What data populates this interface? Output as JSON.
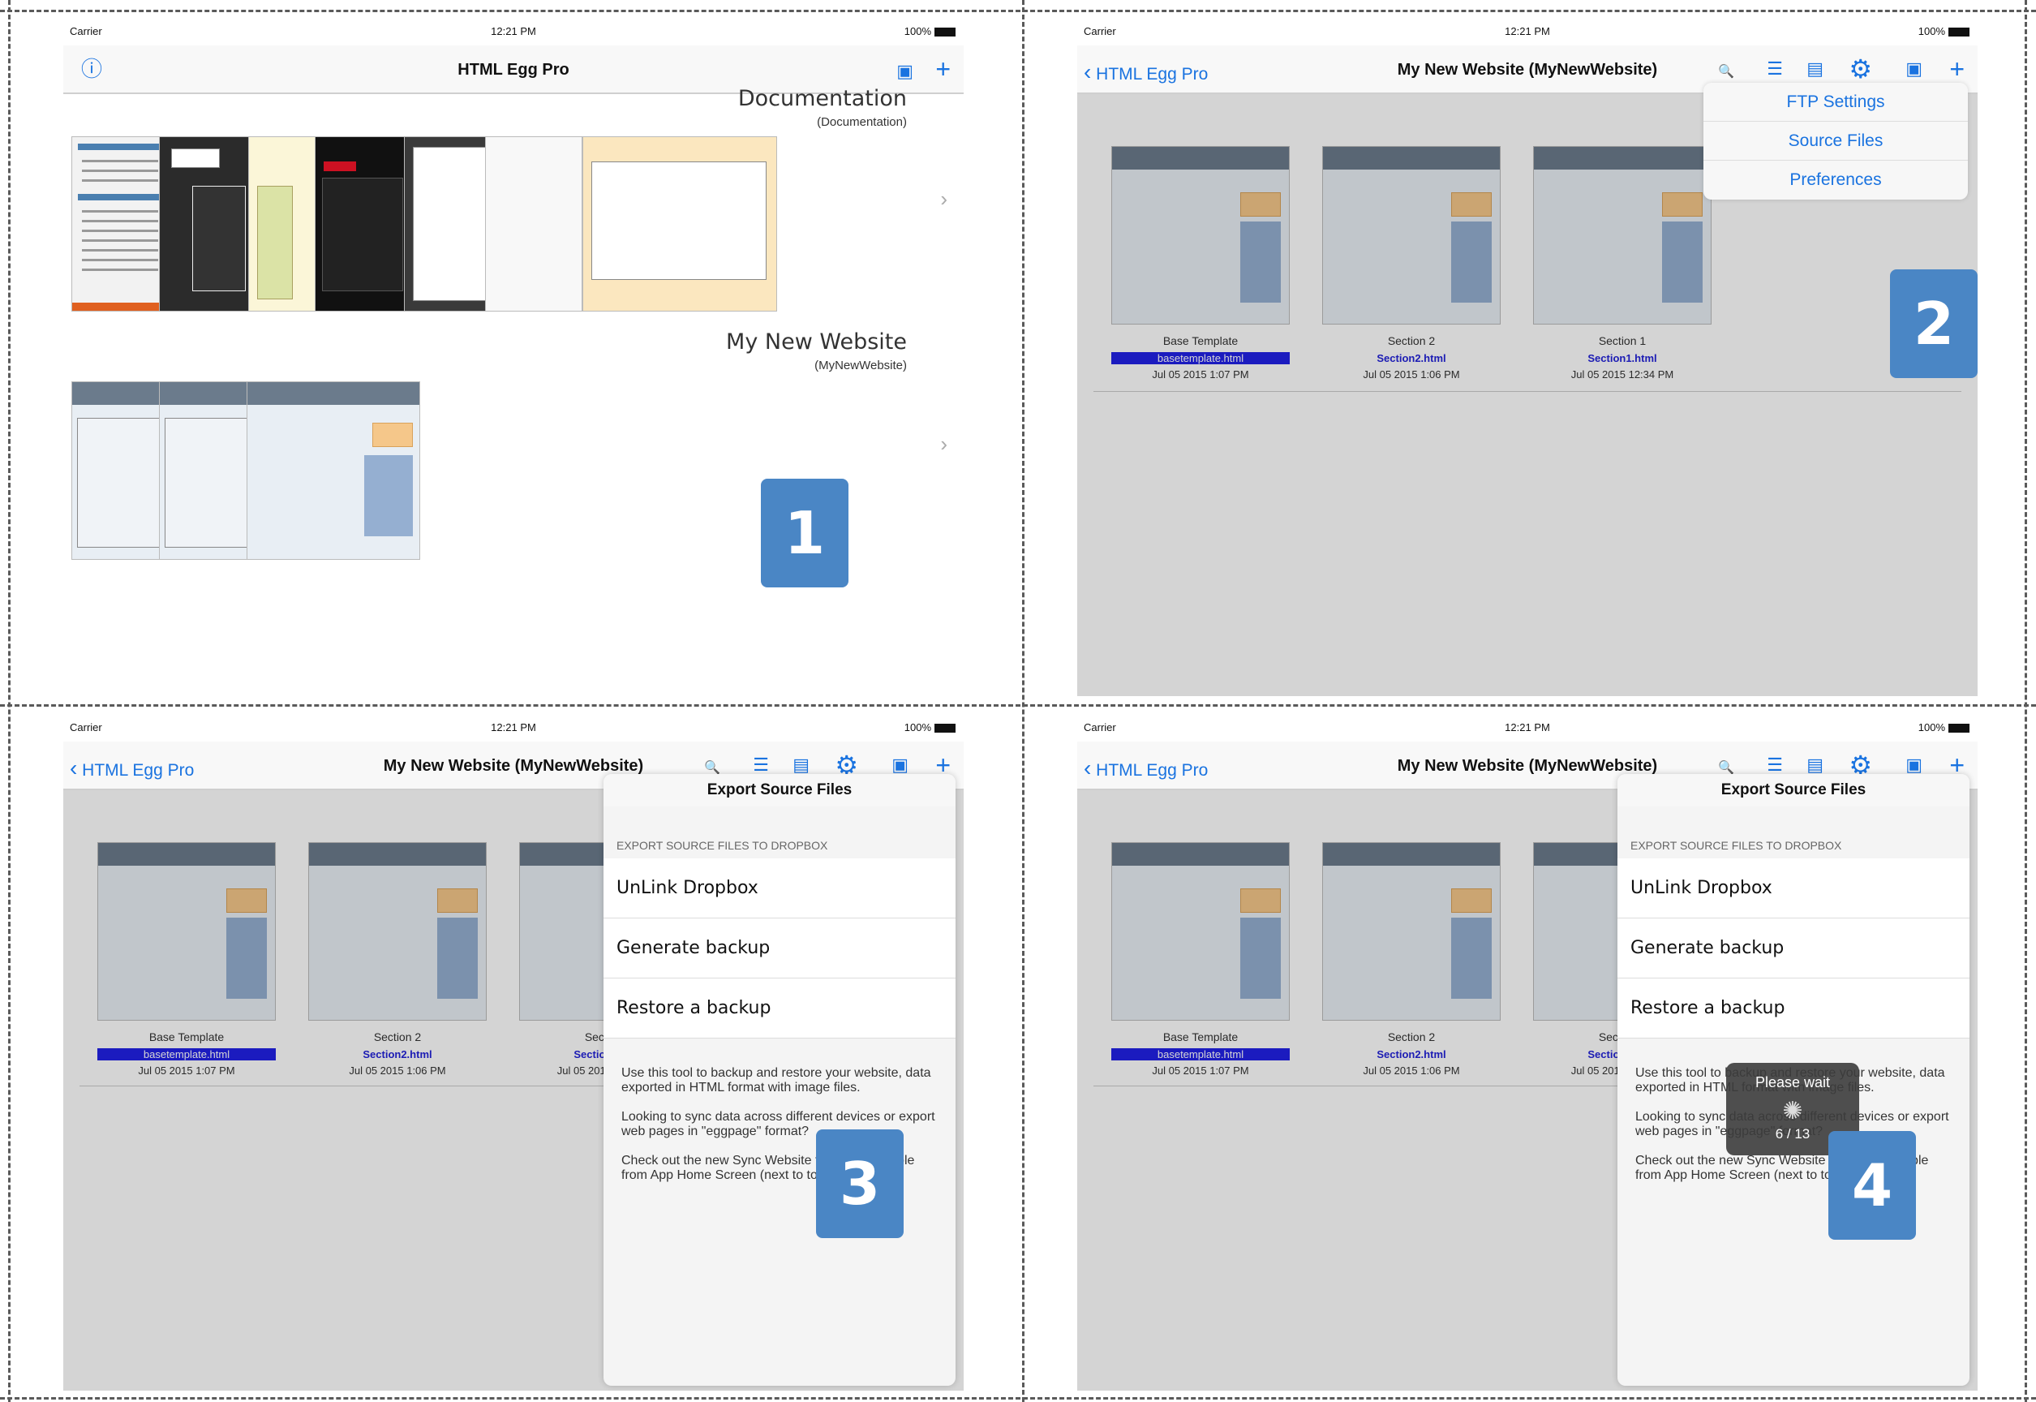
{
  "status": {
    "carrier": "Carrier",
    "time": "12:21 PM",
    "battery": "100%"
  },
  "panel1": {
    "app_title": "HTML Egg Pro",
    "groups": [
      {
        "title": "Documentation",
        "subtitle": "(Documentation)"
      },
      {
        "title": "My New Website",
        "subtitle": "(MyNewWebsite)"
      }
    ],
    "badge": "1"
  },
  "site_nav": {
    "back_label": "HTML Egg Pro",
    "title": "My New Website (MyNewWebsite)"
  },
  "files": [
    {
      "name": "Base Template",
      "file": "basetemplate.html",
      "date": "Jul 05 2015 1:07 PM"
    },
    {
      "name": "Section 2",
      "file": "Section2.html",
      "date": "Jul 05 2015 1:06 PM"
    },
    {
      "name": "Section 1",
      "file": "Section1.html",
      "date": "Jul 05 2015 12:34 PM"
    }
  ],
  "panel2": {
    "menu": [
      "FTP Settings",
      "Source Files",
      "Preferences"
    ],
    "badge": "2"
  },
  "export": {
    "title": "Export Source Files",
    "section": "EXPORT SOURCE FILES TO DROPBOX",
    "rows": [
      "UnLink Dropbox",
      "Generate backup",
      "Restore a backup"
    ],
    "desc1": "Use this tool to backup and restore your website, data exported in HTML format with image files.",
    "desc2": "Looking to sync data across different devices or export web pages in \"eggpage\" format?",
    "desc3": "Check out the new Sync Website feature. Available from App Home Screen (next to toolbar button)."
  },
  "panel3": {
    "badge": "3"
  },
  "panel4": {
    "badge": "4",
    "hud_title": "Please wait",
    "hud_progress": "6 / 13",
    "hud_spinner": "✺"
  },
  "icons": {
    "info": "ⓘ",
    "plus": "+",
    "search": "🔍",
    "gear": "⚙",
    "chevron": "›",
    "back": "‹"
  },
  "colors": {
    "accent": "#1a73e0",
    "badge": "#4a86c5",
    "selected_file": "#2121e6"
  }
}
